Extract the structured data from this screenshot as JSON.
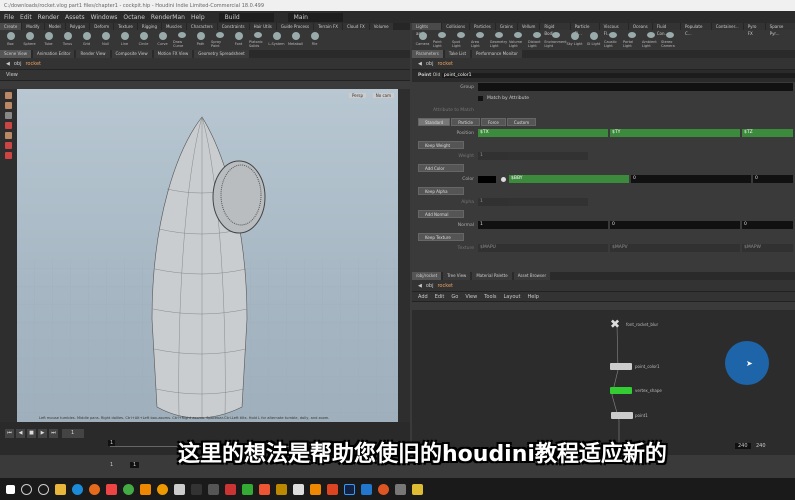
{
  "window": {
    "title": "C:/downloads/rocket.vlog part1 files/chapter1 - cockpit.hip - Houdini Indie Limited-Commercial 18.0.499"
  },
  "menu": [
    "File",
    "Edit",
    "Render",
    "Assets",
    "Windows",
    "Octane",
    "RenderMan",
    "Help"
  ],
  "desktop": "Build",
  "context": "Main",
  "shelf_left": {
    "tabs": [
      "Create",
      "Modify",
      "Model",
      "Polygon",
      "Deform",
      "Texture",
      "Rigging",
      "Muscles",
      "Characters",
      "Constraints",
      "Hair Utils",
      "Guide Process",
      "Terrain FX",
      "Cloud FX",
      "Volume"
    ],
    "tools": [
      "Box",
      "Sphere",
      "Tube",
      "Torus",
      "Grid",
      "Null",
      "Line",
      "Circle",
      "Curve",
      "Draw Curve",
      "Path",
      "Spray Paint",
      "Font",
      "Platonic Solids",
      "L-System",
      "Metaball",
      "File"
    ]
  },
  "left_panes": [
    "Scene View",
    "Animation Editor",
    "Render View",
    "Composite View",
    "Motion FX View",
    "Geometry Spreadsheet"
  ],
  "path": "rocket",
  "path_obj": "obj",
  "viewport": {
    "label": "View",
    "camera": "Persp",
    "cam": "No cam",
    "status": "Left mouse tumbles. Middle pans. Right dollies. Ctrl+Alt+Left box-zooms. Ctrl+Right zooms. Spacebar-Ctrl-Left tilts. Hold L for alternate tumble, dolly, and zoom."
  },
  "timeline": {
    "frame": "1",
    "start": "1",
    "start2": "1",
    "end": "240",
    "end2": "240"
  },
  "shelf_right": {
    "tabs": [
      "Lights and...",
      "Collisions",
      "Particles",
      "Grains",
      "Vellum",
      "Rigid Bodies",
      "Particle Fl...",
      "Viscous Fl...",
      "Oceans",
      "Fluid Con...",
      "Populate C...",
      "Container...",
      "Pyro FX",
      "Sparse Pyr..."
    ],
    "tools": [
      "Camera",
      "Point Light",
      "Spot Light",
      "Area Light",
      "Geometry Light",
      "Volume Light",
      "Distant Light",
      "Environment Light",
      "Sky Light",
      "GI Light",
      "Caustic Light",
      "Portal Light",
      "Ambient Light",
      "Stereo Camera"
    ]
  },
  "right_panes": [
    "Parameters",
    "Take List",
    "Performance Monitor"
  ],
  "params": {
    "node_type": "Point",
    "node_old": "Old",
    "node_name": "point_color1",
    "group_label": "Group",
    "match_label": "Match by Attribute",
    "attr_match_label": "Attribute to Match",
    "tabs": [
      "Standard",
      "Particle",
      "Force",
      "Custom"
    ],
    "position_label": "Position",
    "position": [
      "$TX",
      "$TY",
      "$TZ"
    ],
    "keep_weight": "Keep Weight",
    "weight_label": "Weight",
    "weight": "1",
    "add_color": "Add Color",
    "color_label": "Color",
    "color": [
      "$BBY",
      "0",
      "0"
    ],
    "keep_alpha": "Keep Alpha",
    "alpha_label": "Alpha",
    "alpha": "1",
    "add_normal": "Add Normal",
    "normal_label": "Normal",
    "normal": [
      "1",
      "0",
      "0"
    ],
    "keep_texture": "Keep Texture",
    "texture_label": "Texture",
    "texture": [
      "$MAPU",
      "$MAPV",
      "$MAPW"
    ]
  },
  "network": {
    "tabs": [
      "/obj/rocket",
      "Tree View",
      "Material Palette",
      "Asset Browser"
    ],
    "menu": [
      "Add",
      "Edit",
      "Go",
      "View",
      "Tools",
      "Layout",
      "Help"
    ],
    "nodes": [
      "font_rocket_blur",
      "point_color1",
      "vertex_shape",
      "point1"
    ]
  },
  "subtitle": "这里的想法是帮助您使旧的houdini教程适应新的",
  "colors": {
    "accent_green": "#3c8a3c",
    "cursor_highlight": "#1e64a8"
  }
}
